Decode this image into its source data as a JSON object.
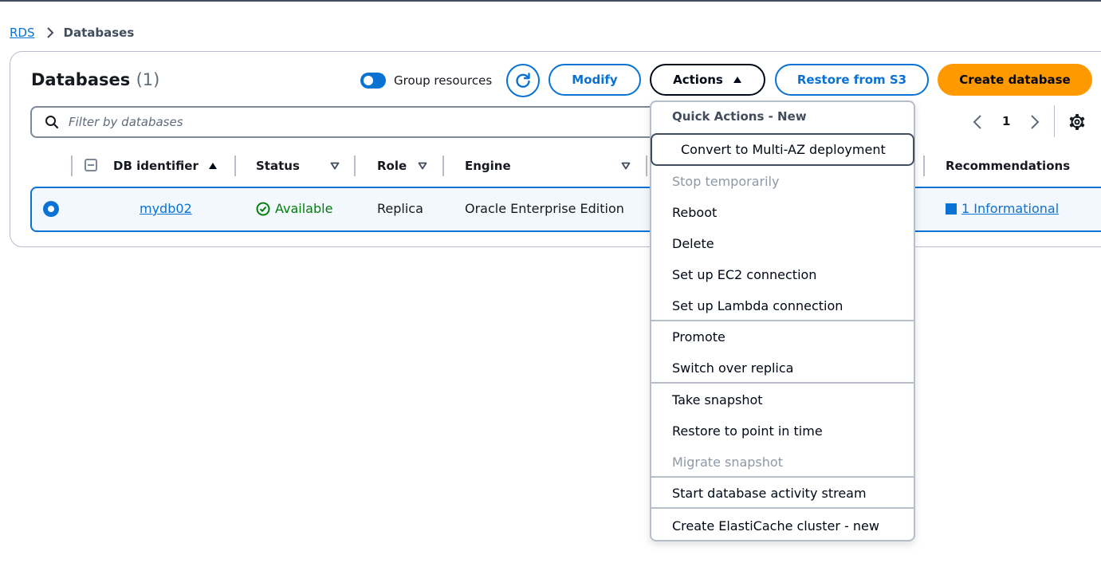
{
  "breadcrumb": {
    "root": "RDS",
    "current": "Databases"
  },
  "header": {
    "title": "Databases",
    "count": "(1)",
    "group_resources_label": "Group resources",
    "group_resources_on": true,
    "modify_label": "Modify",
    "actions_label": "Actions",
    "restore_label": "Restore from S3",
    "create_label": "Create database"
  },
  "filter": {
    "placeholder": "Filter by databases"
  },
  "pagination": {
    "page": "1"
  },
  "table": {
    "columns": {
      "db_identifier": "DB identifier",
      "status": "Status",
      "role": "Role",
      "engine": "Engine",
      "recommendations": "Recommendations"
    },
    "rows": [
      {
        "db_identifier": "mydb02",
        "status": "Available",
        "role": "Replica",
        "engine": "Oracle Enterprise Edition",
        "recommendations": "1 Informational"
      }
    ]
  },
  "actions_menu": {
    "group_title": "Quick Actions - New",
    "items": [
      "Convert to Multi-AZ deployment",
      "Stop temporarily",
      "Reboot",
      "Delete",
      "Set up EC2 connection",
      "Set up Lambda connection",
      "Promote",
      "Switch over replica",
      "Take snapshot",
      "Restore to point in time",
      "Migrate snapshot",
      "Start database activity stream",
      "Create ElastiCache cluster - new"
    ]
  },
  "colors": {
    "accent": "#0972d3",
    "primary_button": "#ff9900",
    "success": "#037f0c",
    "disabled_text": "#8d99a8"
  }
}
